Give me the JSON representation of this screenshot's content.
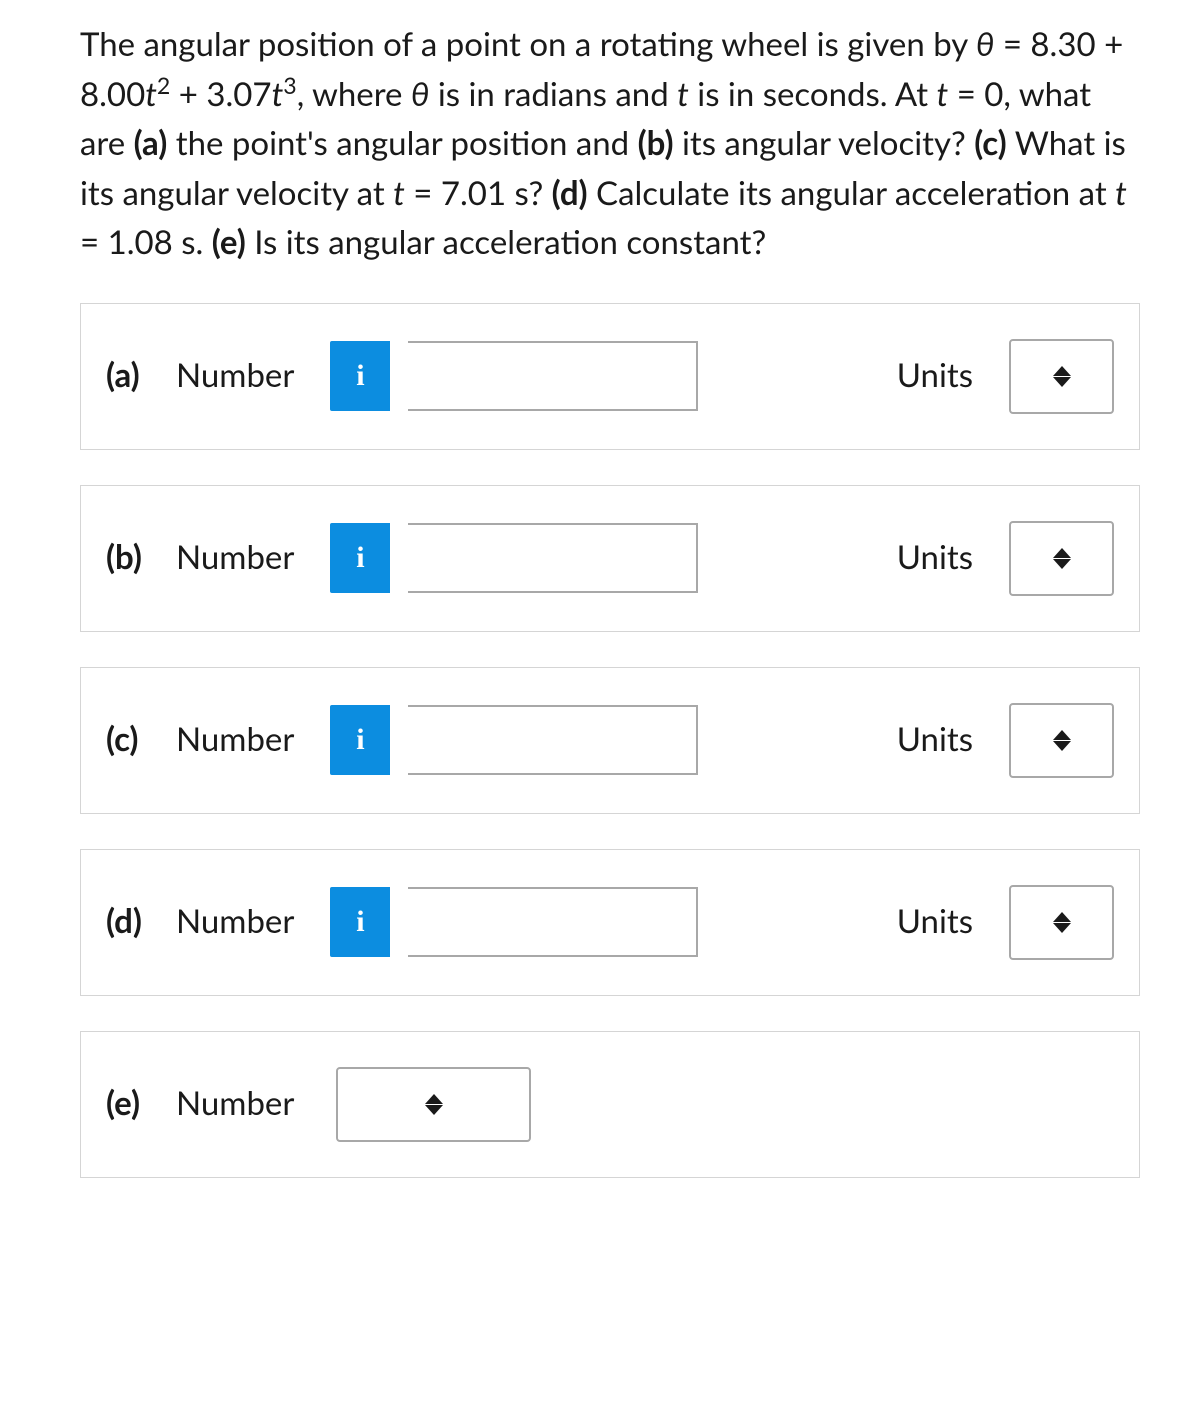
{
  "question": {
    "part1": "The angular position of a point on a rotating wheel is given by ",
    "eq_theta": "θ",
    "eq_equals": " = 8.30 + 8.00",
    "eq_t1": "t",
    "eq_sup2": "2",
    "eq_plus": " + 3.07",
    "eq_t2": "t",
    "eq_sup3": "3",
    "part2": ", where ",
    "eq_theta2": "θ",
    "part3": " is in radians and ",
    "eq_t3": "t",
    "part4": " is in seconds. At ",
    "eq_t4": "t",
    "part5": " = 0, what are ",
    "label_a": "(a)",
    "part6": " the point's angular position and ",
    "label_b": "(b)",
    "part7": " its angular velocity? ",
    "label_c": "(c)",
    "part8": " What is its angular velocity at ",
    "eq_t5": "t",
    "part9": " = 7.01 s? ",
    "label_d": "(d)",
    "part10": " Calculate its angular acceleration at ",
    "eq_t6": "t",
    "part11": " = 1.08 s. ",
    "label_e": "(e)",
    "part12": " Is its angular acceleration constant?"
  },
  "answers": [
    {
      "part": "(a)",
      "label": "Number",
      "units": "Units",
      "has_info": true,
      "has_units": true
    },
    {
      "part": "(b)",
      "label": "Number",
      "units": "Units",
      "has_info": true,
      "has_units": true
    },
    {
      "part": "(c)",
      "label": "Number",
      "units": "Units",
      "has_info": true,
      "has_units": true
    },
    {
      "part": "(d)",
      "label": "Number",
      "units": "Units",
      "has_info": true,
      "has_units": true
    },
    {
      "part": "(e)",
      "label": "Number",
      "units": "",
      "has_info": false,
      "has_units": false
    }
  ],
  "info_glyph": "i"
}
